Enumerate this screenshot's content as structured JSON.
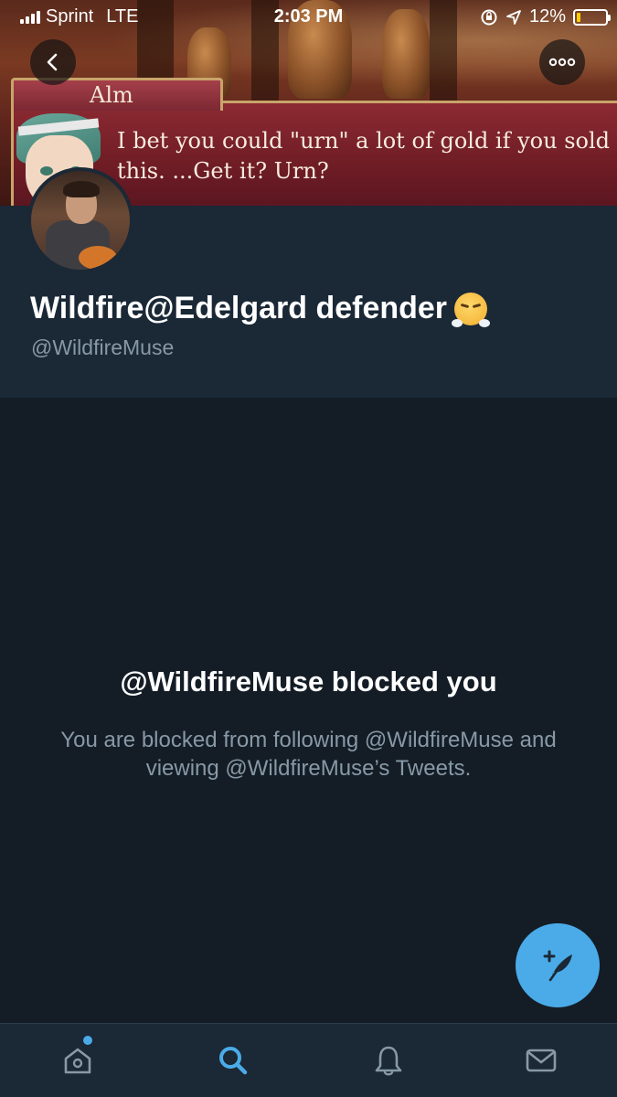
{
  "status_bar": {
    "carrier": "Sprint",
    "network": "LTE",
    "time": "2:03 PM",
    "battery_percent": "12%",
    "battery_level": 0.12,
    "icons": [
      "signal-icon",
      "orientation-lock-icon",
      "location-icon",
      "battery-icon"
    ]
  },
  "banner": {
    "speaker_name": "Alm",
    "dialog_text": "I bet you could \"urn\" a lot of gold if you sold this. ...Get it? Urn?"
  },
  "header_buttons": {
    "back_icon": "chevron-left-icon",
    "more_icon": "more-icon"
  },
  "profile": {
    "display_name": "Wildfire@Edelgard defender",
    "name_emoji": "face-with-steam-emoji",
    "handle": "@WildfireMuse"
  },
  "blocked": {
    "title": "@WildfireMuse blocked you",
    "message": "You are blocked from following @WildfireMuse and viewing @WildfireMuse’s Tweets."
  },
  "fab": {
    "icon": "compose-tweet-icon"
  },
  "tabbar": {
    "tabs": [
      {
        "name": "home",
        "icon": "home-icon",
        "has_badge": true,
        "active": false
      },
      {
        "name": "search",
        "icon": "search-icon",
        "has_badge": false,
        "active": true
      },
      {
        "name": "notifications",
        "icon": "bell-icon",
        "has_badge": false,
        "active": false
      },
      {
        "name": "messages",
        "icon": "mail-icon",
        "has_badge": false,
        "active": false
      }
    ]
  },
  "colors": {
    "background": "#141d26",
    "header_background": "#1b2836",
    "accent": "#4aabe8",
    "secondary_text": "#8899a6",
    "battery_low": "#ffcc00"
  }
}
